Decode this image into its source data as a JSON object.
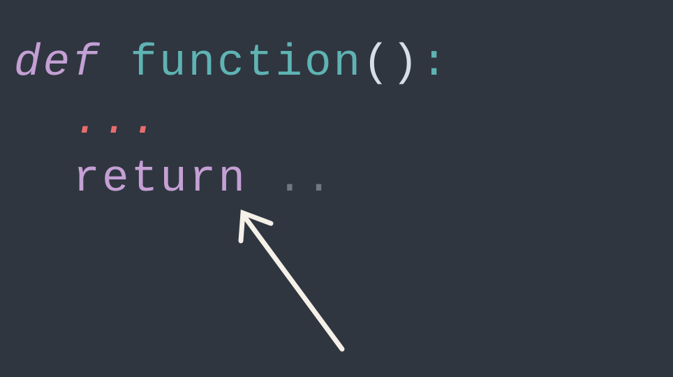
{
  "code": {
    "line1": {
      "def": "def",
      "space1": " ",
      "name": "function",
      "parens": "()",
      "colon": ":"
    },
    "line2": {
      "indent": "    ",
      "ellipsis": "..."
    },
    "line3": {
      "indent": "    ",
      "return": "return",
      "space": " ",
      "dots": ".."
    }
  }
}
